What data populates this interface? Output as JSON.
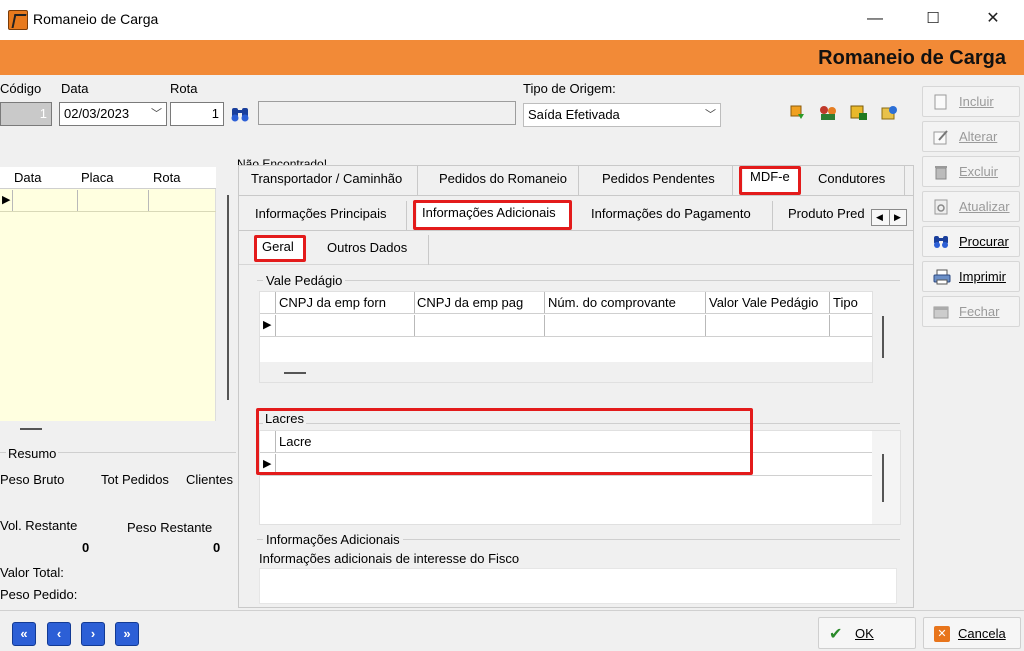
{
  "window": {
    "title": "Romaneio de Carga",
    "min": "—",
    "max": "☐",
    "close": "✕"
  },
  "banner": {
    "title": "Romaneio de Carga"
  },
  "header": {
    "codigo_label": "Código",
    "codigo_value": "1",
    "data_label": "Data",
    "data_value": "02/03/2023",
    "rota_label": "Rota",
    "rota_value": "1",
    "tipo_origem_label": "Tipo de Origem:",
    "tipo_origem_value": "Saída Efetivada",
    "nao_encontrado": "Não Encontrado!"
  },
  "left_grid": {
    "columns": [
      "Data",
      "Placa",
      "Rota"
    ]
  },
  "resumo": {
    "title": "Resumo",
    "peso_bruto": "Peso Bruto",
    "tot_pedidos": "Tot Pedidos",
    "clientes": "Clientes",
    "vol_restante": "Vol. Restante",
    "vol_restante_value": "0",
    "peso_restante": "Peso Restante",
    "peso_restante_value": "0",
    "valor_total": "Valor Total:",
    "peso_pedido": "Peso Pedido:"
  },
  "tabs_main": [
    "Transportador / Caminhão",
    "Pedidos do Romaneio",
    "Pedidos Pendentes",
    "MDF-e",
    "Condutores"
  ],
  "tabs_sub": [
    "Informações Principais",
    "Informações Adicionais",
    "Informações do Pagamento",
    "Produto Pred"
  ],
  "tabs_sub2": [
    "Geral",
    "Outros Dados"
  ],
  "vale_pedagio": {
    "title": "Vale Pedágio",
    "columns": [
      "CNPJ da emp forn",
      "CNPJ da emp pag",
      "Núm. do comprovante",
      "Valor Vale Pedágio",
      "Tipo"
    ]
  },
  "lacres": {
    "title": "Lacres",
    "column": "Lacre"
  },
  "info_adicionais": {
    "title": "Informações Adicionais",
    "label": "Informações adicionais de interesse do Fisco"
  },
  "actions": {
    "incluir": "Incluir",
    "alterar": "Alterar",
    "excluir": "Excluir",
    "atualizar": "Atualizar",
    "procurar": "Procurar",
    "imprimir": "Imprimir",
    "fechar": "Fechar"
  },
  "footer": {
    "ok": "OK",
    "cancela": "Cancela",
    "nav": [
      "«",
      "‹",
      "›",
      "»"
    ]
  },
  "colors": {
    "banner": "#f28a37",
    "highlight": "#e31b1b",
    "nav_blue": "#2c5fd6"
  }
}
